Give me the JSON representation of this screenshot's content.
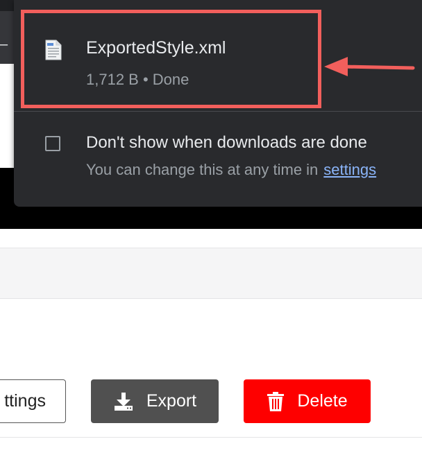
{
  "download": {
    "file_name": "ExportedStyle.xml",
    "status": "1,712 B • Done"
  },
  "preferences": {
    "dont_show_label": "Don't show when downloads are done",
    "change_note": "You can change this at any time in",
    "settings_link": "settings"
  },
  "actions": {
    "settings_label": "ttings",
    "export_label": "Export",
    "delete_label": "Delete"
  },
  "colors": {
    "popup_bg": "#292a2d",
    "highlight": "#f25f5c",
    "link": "#8ab4f8",
    "export_btn": "#505050",
    "delete_btn": "#fe0000"
  },
  "icons": [
    "document-icon",
    "arrow-left-icon",
    "download-icon",
    "trash-icon",
    "checkbox-icon"
  ]
}
